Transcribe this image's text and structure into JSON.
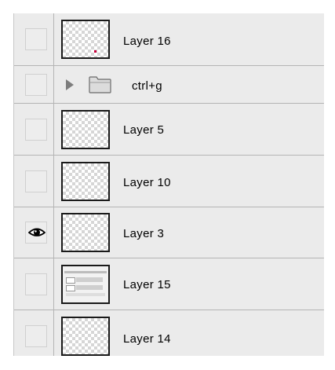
{
  "layers_panel": {
    "rows": [
      {
        "name": "Layer 16",
        "visible": false,
        "type": "layer",
        "thumbnail": "transparent-with-red-dot"
      },
      {
        "name": "ctrl+g",
        "visible": false,
        "type": "group",
        "collapsed": true
      },
      {
        "name": "Layer 5",
        "visible": false,
        "type": "layer",
        "thumbnail": "transparent"
      },
      {
        "name": "Layer 10",
        "visible": false,
        "type": "layer",
        "thumbnail": "transparent"
      },
      {
        "name": "Layer 3",
        "visible": true,
        "type": "layer",
        "thumbnail": "transparent"
      },
      {
        "name": "Layer 15",
        "visible": false,
        "type": "layer",
        "thumbnail": "screenshot-preview"
      },
      {
        "name": "Layer 14",
        "visible": false,
        "type": "layer",
        "thumbnail": "transparent"
      }
    ]
  },
  "icons": {
    "visibility": "eye-icon",
    "group_toggle": "triangle-right-icon",
    "group": "folder-icon"
  }
}
